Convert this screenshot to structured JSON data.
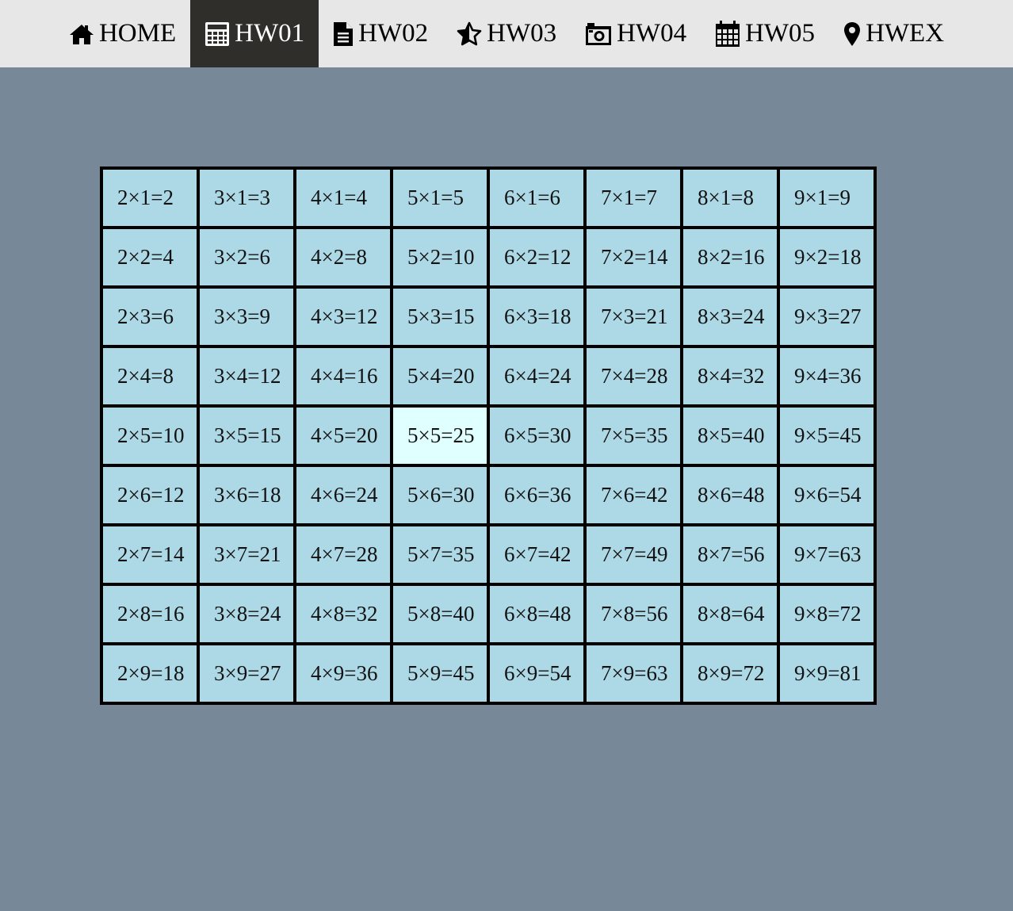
{
  "nav": {
    "items": [
      {
        "label": "HOME",
        "icon": "home-icon",
        "active": false
      },
      {
        "label": "HW01",
        "icon": "calculator-icon",
        "active": true
      },
      {
        "label": "HW02",
        "icon": "file-icon",
        "active": false
      },
      {
        "label": "HW03",
        "icon": "star-half-icon",
        "active": false
      },
      {
        "label": "HW04",
        "icon": "camera-icon",
        "active": false
      },
      {
        "label": "HW05",
        "icon": "calendar-icon",
        "active": false
      },
      {
        "label": "HWEX",
        "icon": "map-marker-icon",
        "active": false
      }
    ],
    "active_bg": "#2f2e2a",
    "bar_bg": "#e7e7e7"
  },
  "page": {
    "background": "#778899"
  },
  "table": {
    "cell_color": "#add8e6",
    "highlight_color": "#e0ffff",
    "rows": [
      [
        "2×1=2",
        "3×1=3",
        "4×1=4",
        "5×1=5",
        "6×1=6",
        "7×1=7",
        "8×1=8",
        "9×1=9"
      ],
      [
        "2×2=4",
        "3×2=6",
        "4×2=8",
        "5×2=10",
        "6×2=12",
        "7×2=14",
        "8×2=16",
        "9×2=18"
      ],
      [
        "2×3=6",
        "3×3=9",
        "4×3=12",
        "5×3=15",
        "6×3=18",
        "7×3=21",
        "8×3=24",
        "9×3=27"
      ],
      [
        "2×4=8",
        "3×4=12",
        "4×4=16",
        "5×4=20",
        "6×4=24",
        "7×4=28",
        "8×4=32",
        "9×4=36"
      ],
      [
        "2×5=10",
        "3×5=15",
        "4×5=20",
        "5×5=25",
        "6×5=30",
        "7×5=35",
        "8×5=40",
        "9×5=45"
      ],
      [
        "2×6=12",
        "3×6=18",
        "4×6=24",
        "5×6=30",
        "6×6=36",
        "7×6=42",
        "8×6=48",
        "9×6=54"
      ],
      [
        "2×7=14",
        "3×7=21",
        "4×7=28",
        "5×7=35",
        "6×7=42",
        "7×7=49",
        "8×7=56",
        "9×7=63"
      ],
      [
        "2×8=16",
        "3×8=24",
        "4×8=32",
        "5×8=40",
        "6×8=48",
        "7×8=56",
        "8×8=64",
        "9×8=72"
      ],
      [
        "2×9=18",
        "3×9=27",
        "4×9=36",
        "5×9=45",
        "6×9=54",
        "7×9=63",
        "8×9=72",
        "9×9=81"
      ]
    ],
    "highlighted_cell": "5×5=25"
  }
}
